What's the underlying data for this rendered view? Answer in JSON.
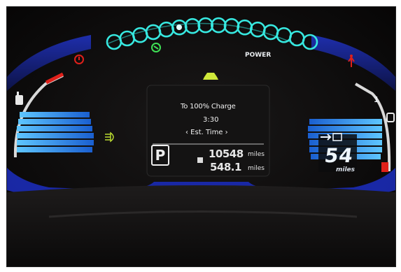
{
  "charge_screen": {
    "line1": "To 100% Charge",
    "line2": "3:30",
    "line3": "‹  Est. Time  ›"
  },
  "gear": "P",
  "odometer": {
    "value": "10548",
    "unit": "miles"
  },
  "trip": {
    "value": "548.1",
    "unit": "miles"
  },
  "power_label": "POWER",
  "range": {
    "value": "54",
    "unit": "miles",
    "top_mark": "1"
  },
  "colors": {
    "ring": "#37e8e0",
    "bar_blue": "#3fb3ff",
    "warning_red": "#e0201a",
    "eco_green": "#3fe055",
    "car_yellow": "#cfe83a",
    "ambient_blue": "#1c2aa8"
  },
  "icons": [
    "eco-icon",
    "warning-icon",
    "car-icon",
    "power-plug-icon",
    "seatbelt-icon",
    "headlight-icon",
    "fuel-door-icon"
  ]
}
